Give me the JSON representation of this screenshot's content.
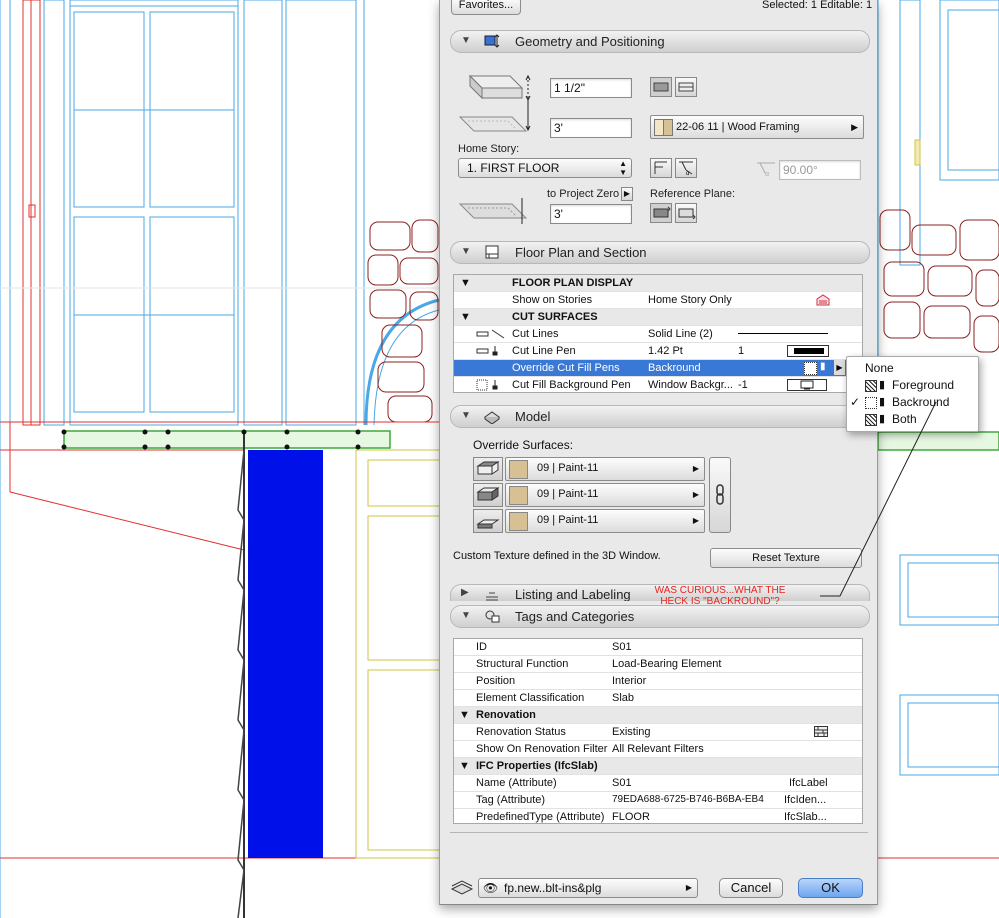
{
  "toolbar": {
    "favorites_label": "Favorites...",
    "selection_status": "Selected: 1 Editable: 1"
  },
  "sections": {
    "geometry": {
      "title": "Geometry and Positioning",
      "thickness": "1 1/2\"",
      "offset": "3'",
      "home_story_label": "Home Story:",
      "home_story_value": "1. FIRST FLOOR",
      "to_project_zero_label": "to Project Zero",
      "project_zero_value": "3'",
      "building_material": "22-06 11 | Wood Framing",
      "angle": "90.00°",
      "reference_plane_label": "Reference Plane:"
    },
    "floor_plan": {
      "title": "Floor Plan and Section",
      "rows": [
        {
          "label": "FLOOR PLAN DISPLAY",
          "value": "",
          "extra": ""
        },
        {
          "label": "Show on Stories",
          "value": "Home Story Only",
          "extra": ""
        },
        {
          "label": "CUT SURFACES",
          "value": "",
          "extra": ""
        },
        {
          "label": "Cut Lines",
          "value": "Solid Line (2)",
          "extra": ""
        },
        {
          "label": "Cut Line Pen",
          "value": "1.42 Pt",
          "extra": "1"
        },
        {
          "label": "Override Cut Fill Pens",
          "value": "Backround",
          "extra": ""
        },
        {
          "label": "Cut Fill Background Pen",
          "value": "Window Backgr...",
          "extra": "-1"
        }
      ]
    },
    "model": {
      "title": "Model",
      "override_label": "Override Surfaces:",
      "surfaces": [
        "09 | Paint-11",
        "09 | Paint-11",
        "09 | Paint-11"
      ],
      "texture_note": "Custom Texture defined in the 3D Window.",
      "reset_texture_label": "Reset Texture"
    },
    "listing": {
      "title": "Listing and Labeling"
    },
    "tags": {
      "title": "Tags and Categories",
      "rows": [
        {
          "label": "ID",
          "value": "S01",
          "extra": ""
        },
        {
          "label": "Structural Function",
          "value": "Load-Bearing Element",
          "extra": ""
        },
        {
          "label": "Position",
          "value": "Interior",
          "extra": ""
        },
        {
          "label": "Element Classification",
          "value": "Slab",
          "extra": ""
        },
        {
          "label": "Renovation",
          "value": "",
          "extra": ""
        },
        {
          "label": "Renovation Status",
          "value": "Existing",
          "extra": ""
        },
        {
          "label": "Show On Renovation Filter",
          "value": "All Relevant Filters",
          "extra": ""
        },
        {
          "label": "IFC Properties (IfcSlab)",
          "value": "",
          "extra": ""
        },
        {
          "label": "Name (Attribute)",
          "value": "S01",
          "extra": "IfcLabel"
        },
        {
          "label": "Tag (Attribute)",
          "value": "79EDA688-6725-B746-B6BA-EB4",
          "extra": "IfcIden..."
        },
        {
          "label": "PredefinedType (Attribute)",
          "value": "FLOOR",
          "extra": "IfcSlab..."
        }
      ]
    }
  },
  "footer": {
    "layer": "fp.new..blt-ins&plg",
    "cancel_label": "Cancel",
    "ok_label": "OK"
  },
  "popup_menu": {
    "items": [
      "None",
      "Foreground",
      "Backround",
      "Both"
    ],
    "checkmark": "✓"
  },
  "annotation": {
    "line1": "WAS CURIOUS...WHAT THE",
    "line2": "HECK IS \"BACKROUND\"?"
  },
  "colors": {
    "selection": "#3a78d6",
    "annotation": "#e8231d",
    "drawing_fill": "#0010e8",
    "surface_swatch": "#d7c194"
  }
}
